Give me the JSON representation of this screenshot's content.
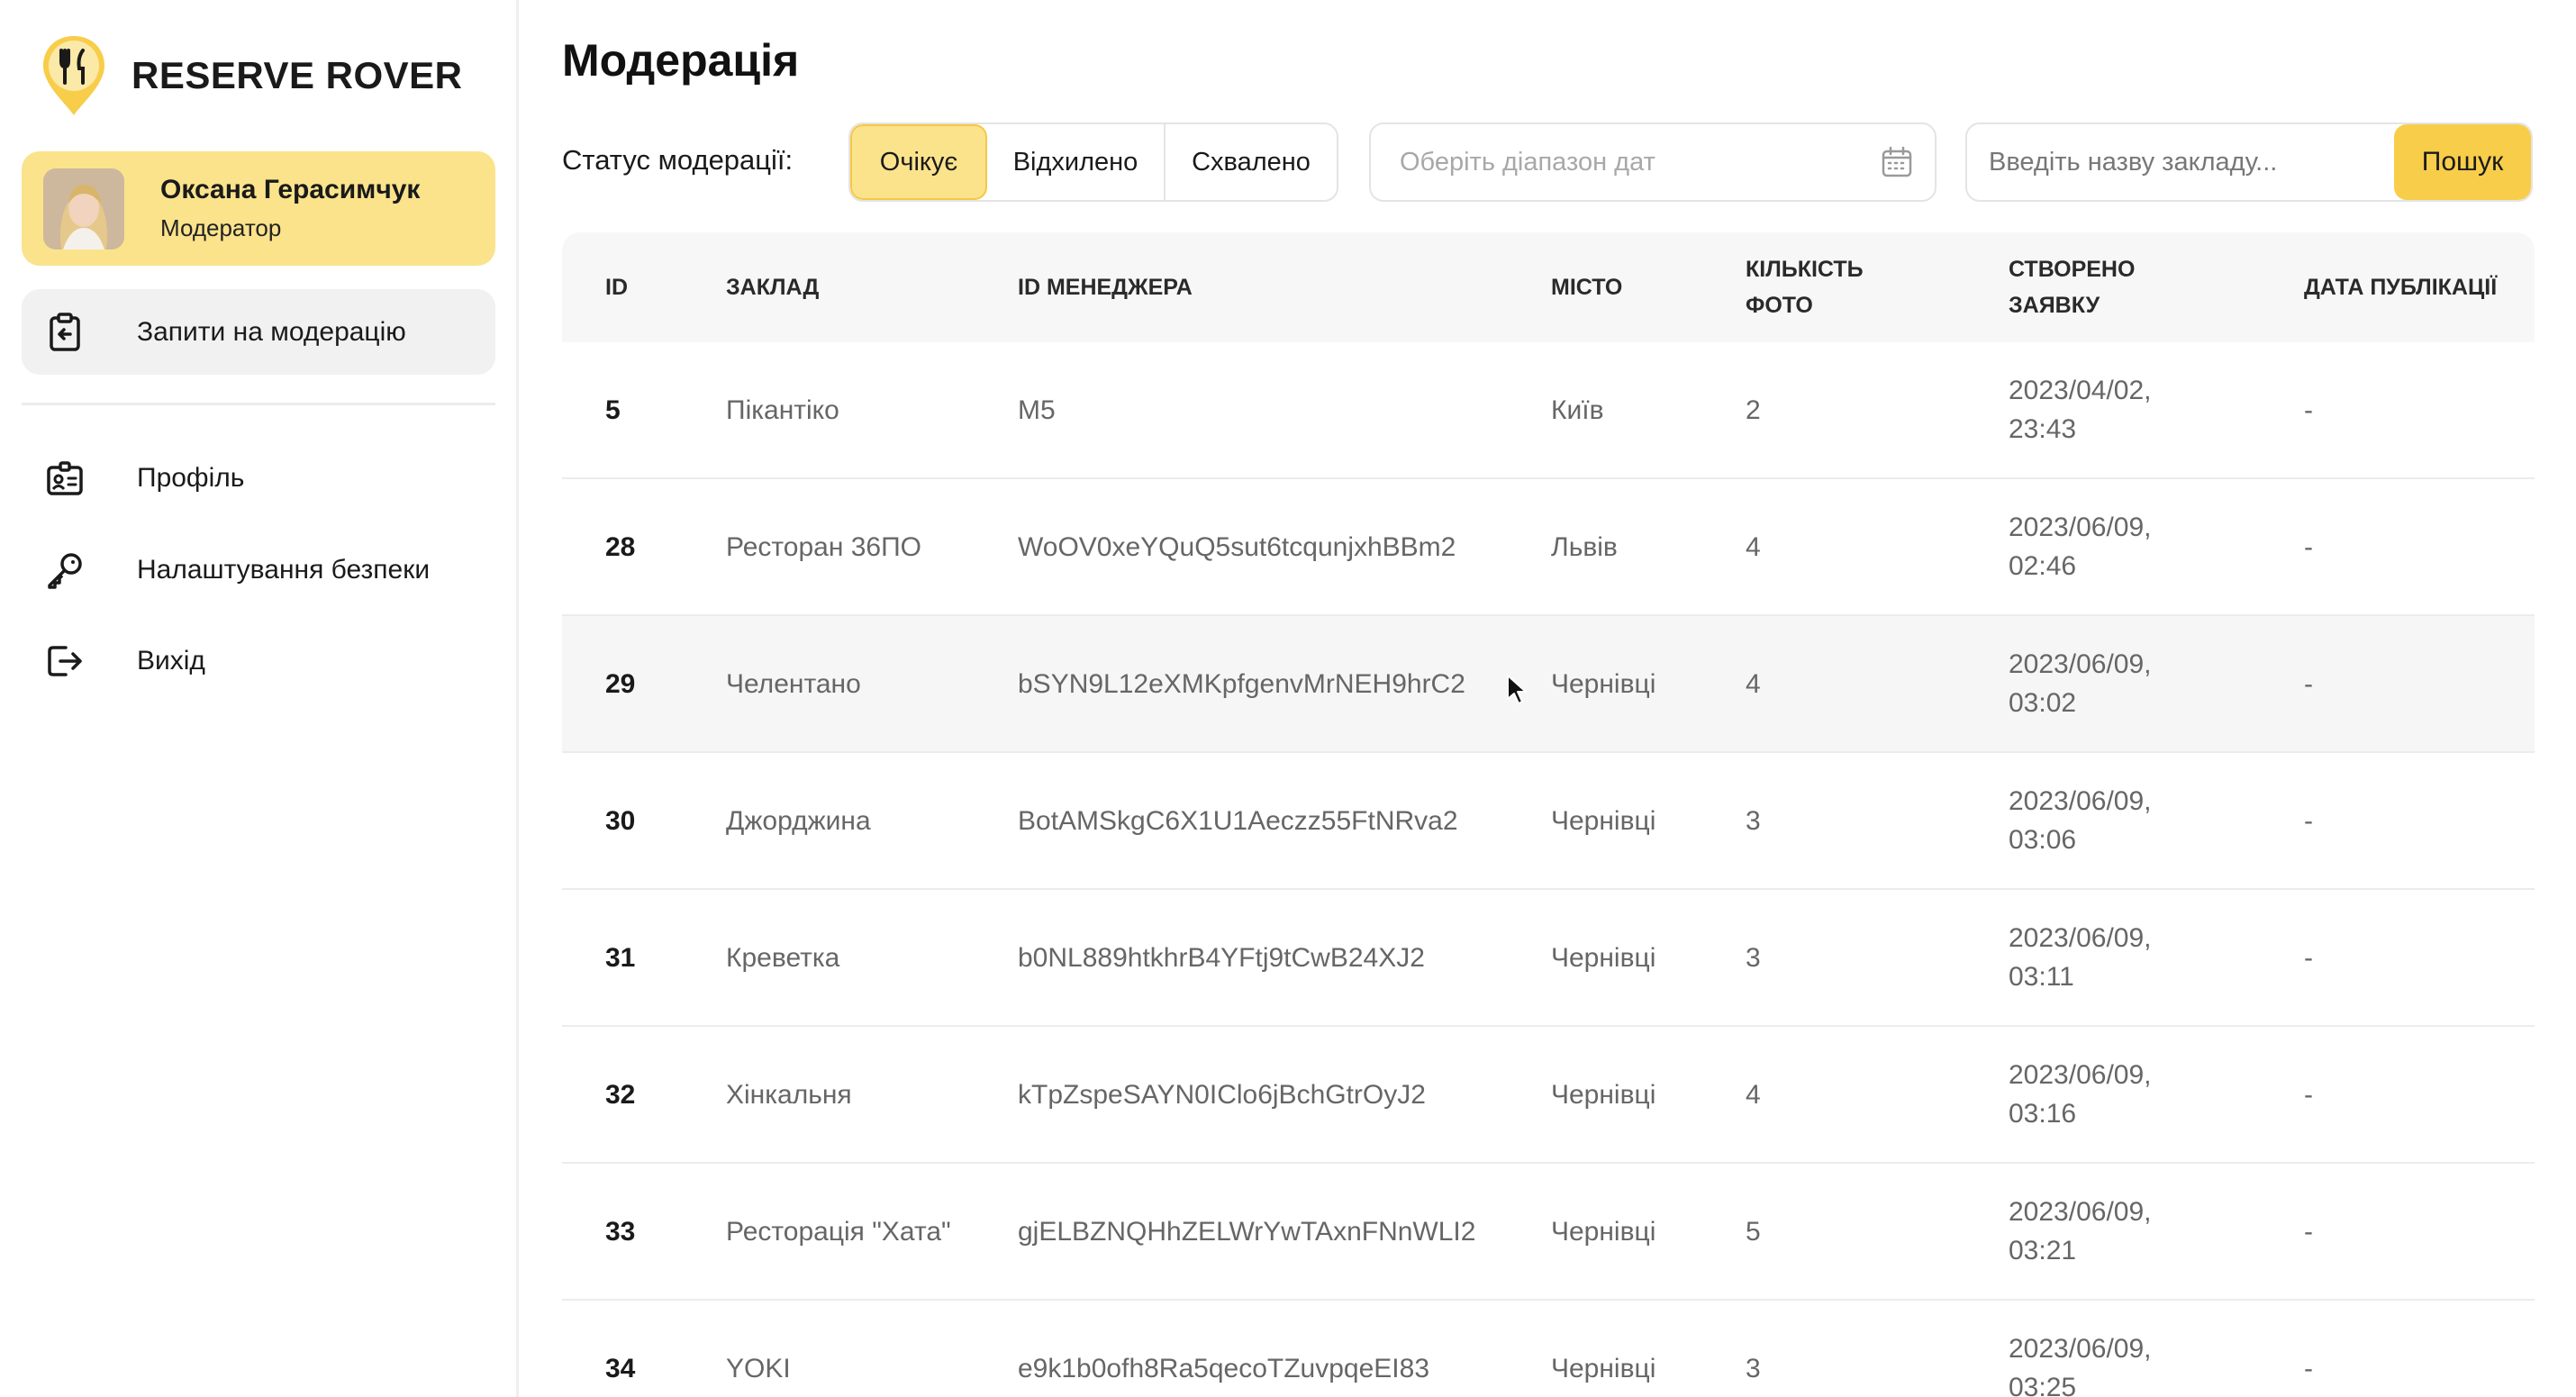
{
  "app": {
    "title": "RESERVE ROVER"
  },
  "user": {
    "name": "Оксана Герасимчук",
    "role": "Модератор"
  },
  "nav": {
    "active": {
      "label": "Запити на модерацію",
      "icon": "clipboard-icon"
    },
    "items": [
      {
        "label": "Профіль",
        "icon": "profile-card-icon"
      },
      {
        "label": "Налаштування безпеки",
        "icon": "key-icon"
      },
      {
        "label": "Вихід",
        "icon": "logout-icon"
      }
    ]
  },
  "page": {
    "title": "Модерація"
  },
  "filters": {
    "status_label": "Статус модерації:",
    "statuses": [
      "Очікує",
      "Відхилено",
      "Схвалено"
    ],
    "active_status": "Очікує",
    "date_placeholder": "Оберіть діапазон дат",
    "search_placeholder": "Введіть назву закладу...",
    "search_button": "Пошук"
  },
  "table": {
    "headers": {
      "id": "ID",
      "place": "ЗАКЛАД",
      "manager_id": "ID МЕНЕДЖЕРА",
      "city": "МІСТО",
      "photos": "КІЛЬКІСТЬ ФОТО",
      "created": "СТВОРЕНО ЗАЯВКУ",
      "published": "ДАТА ПУБЛІКАЦІЇ"
    },
    "rows": [
      {
        "id": "5",
        "place": "Пікантіко",
        "manager_id": "M5",
        "city": "Київ",
        "photos": "2",
        "created": "2023/04/02, 23:43",
        "published": "-"
      },
      {
        "id": "28",
        "place": "Ресторан 36ПО",
        "manager_id": "WoOV0xeYQuQ5sut6tcqunjxhBBm2",
        "city": "Львів",
        "photos": "4",
        "created": "2023/06/09, 02:46",
        "published": "-"
      },
      {
        "id": "29",
        "place": "Челентано",
        "manager_id": "bSYN9L12eXMKpfgenvMrNEH9hrC2",
        "city": "Чернівці",
        "photos": "4",
        "created": "2023/06/09, 03:02",
        "published": "-"
      },
      {
        "id": "30",
        "place": "Джорджина",
        "manager_id": "BotAMSkgC6X1U1Aeczz55FtNRva2",
        "city": "Чернівці",
        "photos": "3",
        "created": "2023/06/09, 03:06",
        "published": "-"
      },
      {
        "id": "31",
        "place": "Креветка",
        "manager_id": "b0NL889htkhrB4YFtj9tCwB24XJ2",
        "city": "Чернівці",
        "photos": "3",
        "created": "2023/06/09, 03:11",
        "published": "-"
      },
      {
        "id": "32",
        "place": "Хінкальня",
        "manager_id": "kTpZspeSAYN0IClo6jBchGtrOyJ2",
        "city": "Чернівці",
        "photos": "4",
        "created": "2023/06/09, 03:16",
        "published": "-"
      },
      {
        "id": "33",
        "place": "Ресторація \"Хата\"",
        "manager_id": "gjELBZNQHhZELWrYwTAxnFNnWLI2",
        "city": "Чернівці",
        "photos": "5",
        "created": "2023/06/09, 03:21",
        "published": "-"
      },
      {
        "id": "34",
        "place": "YOKI",
        "manager_id": "e9k1b0ofh8Ra5qecoTZuvpqeEI83",
        "city": "Чернівці",
        "photos": "3",
        "created": "2023/06/09, 03:25",
        "published": "-"
      }
    ]
  },
  "colors": {
    "accent": "#f7cd4a",
    "accent_light": "#fbe38c",
    "hover_row": "#f6f6f6"
  }
}
